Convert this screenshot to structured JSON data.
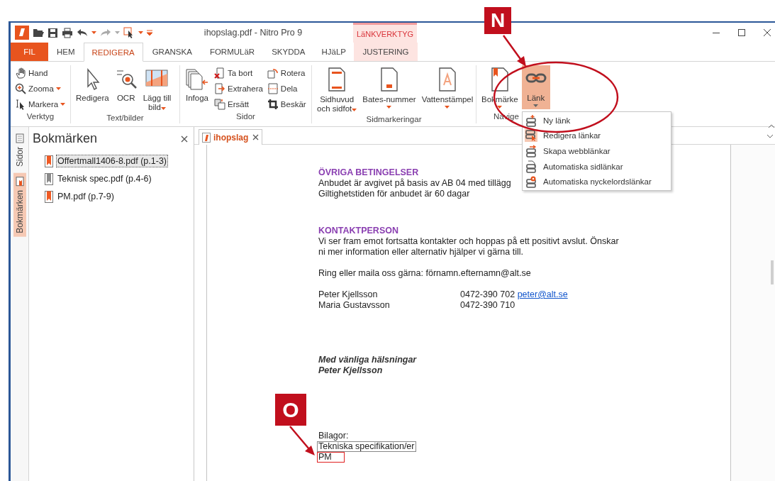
{
  "window": {
    "title": "ihopslag.pdf - Nitro Pro 9",
    "context_group": "LäNKVERKTYG"
  },
  "tabs": [
    {
      "label": "FIL",
      "kind": "file",
      "selected": false
    },
    {
      "label": "HEM",
      "kind": "tab",
      "selected": false
    },
    {
      "label": "REDIGERA",
      "kind": "tab",
      "selected": true
    },
    {
      "label": "GRANSKA",
      "kind": "tab",
      "selected": false
    },
    {
      "label": "FORMULäR",
      "kind": "tab",
      "selected": false
    },
    {
      "label": "SKYDDA",
      "kind": "tab",
      "selected": false
    },
    {
      "label": "HJäLP",
      "kind": "tab",
      "selected": false
    },
    {
      "label": "JUSTERING",
      "kind": "context",
      "selected": false
    }
  ],
  "ribbon": {
    "groups": [
      {
        "label": "Verktyg",
        "items": [
          {
            "label": "Hand",
            "kind": "small",
            "dropdown": false,
            "active": false
          },
          {
            "label": "Zooma",
            "kind": "small",
            "dropdown": true,
            "active": false
          },
          {
            "label": "Markera",
            "kind": "small",
            "dropdown": true,
            "active": false
          }
        ]
      },
      {
        "label": "Text/bilder",
        "items": [
          {
            "label": "Redigera",
            "kind": "large",
            "dropdown": false,
            "active": false
          },
          {
            "label": "OCR",
            "kind": "large",
            "dropdown": false,
            "active": false
          },
          {
            "label": "Lägg till\nbild",
            "kind": "large",
            "dropdown": true,
            "active": false
          }
        ]
      },
      {
        "label": "Sidor",
        "items": [
          {
            "label": "Infoga",
            "kind": "large",
            "dropdown": false,
            "active": false
          },
          {
            "label": "Ta bort",
            "kind": "small",
            "dropdown": false,
            "active": false
          },
          {
            "label": "Extrahera",
            "kind": "small",
            "dropdown": false,
            "active": false
          },
          {
            "label": "Ersätt",
            "kind": "small",
            "dropdown": false,
            "active": false
          },
          {
            "label": "Rotera",
            "kind": "small",
            "dropdown": false,
            "active": false
          },
          {
            "label": "Dela",
            "kind": "small",
            "dropdown": false,
            "active": false
          },
          {
            "label": "Beskär",
            "kind": "small",
            "dropdown": false,
            "active": false
          }
        ]
      },
      {
        "label": "Sidmarkeringar",
        "items": [
          {
            "label": "Sidhuvud\noch sidfot",
            "kind": "large",
            "dropdown": true,
            "active": false
          },
          {
            "label": "Bates-nummer",
            "kind": "large",
            "dropdown": true,
            "active": false
          },
          {
            "label": "Vattenstämpel",
            "kind": "large",
            "dropdown": true,
            "active": false
          }
        ]
      },
      {
        "label": "Navige",
        "items": [
          {
            "label": "Bokmärke",
            "kind": "large",
            "dropdown": true,
            "active": false
          },
          {
            "label": "Länk",
            "kind": "large",
            "dropdown": true,
            "active": true
          }
        ]
      }
    ]
  },
  "side_tabs": [
    {
      "label": "Sidor",
      "selected": false
    },
    {
      "label": "Bokmärken",
      "selected": true
    }
  ],
  "bookmarks": {
    "title": "Bokmärken",
    "items": [
      {
        "label": "Offertmall1406-8.pdf (p.1-3)",
        "selected": true,
        "color": "#f05a24"
      },
      {
        "label": "Teknisk spec.pdf (p.4-6)",
        "selected": false,
        "color": "#8a8a8a"
      },
      {
        "label": "PM.pdf (p.7-9)",
        "selected": false,
        "color": "#f05a24"
      }
    ]
  },
  "document": {
    "tab": {
      "label": "ihopslag",
      "selected": true
    },
    "blocks": [
      {
        "kind": "heading",
        "text": "ÖVRIGA BETINGELSER"
      },
      {
        "kind": "paragraph",
        "lines": [
          "Anbudet är avgivet på basis av AB 04 med tillägg",
          "Giltighetstiden för anbudet är 60 dagar"
        ]
      },
      {
        "kind": "heading",
        "text": "KONTAKTPERSON"
      },
      {
        "kind": "paragraph",
        "lines": [
          "Vi ser fram emot fortsatta kontakter och hoppas på ett positivt avslut. Önskar",
          "ni mer information eller alternativ hjälper vi gärna till."
        ]
      },
      {
        "kind": "paragraph",
        "lines": [
          "Ring eller maila oss gärna: förnamn.efternamn@alt.se"
        ]
      },
      {
        "kind": "contacts",
        "rows": [
          {
            "name": "Peter Kjellsson",
            "phone": "0472-390 702",
            "email": "peter@alt.se"
          },
          {
            "name": "Maria Gustavsson",
            "phone": "0472-390 710"
          }
        ]
      },
      {
        "kind": "closing",
        "lines": [
          "Med vänliga hälsningar",
          "Peter Kjellsson"
        ]
      },
      {
        "kind": "attachments",
        "label": "Bilagor:",
        "links": [
          {
            "text": "Tekniska specifikation/er",
            "selected": false
          },
          {
            "text": "PM",
            "selected": true
          }
        ]
      }
    ]
  },
  "link_menu": {
    "items": [
      {
        "label": "Ny länk",
        "checked": false
      },
      {
        "label": "Redigera länkar",
        "checked": true
      },
      {
        "label": "Skapa webblänkar",
        "checked": false
      },
      {
        "label": "Automatiska sidlänkar",
        "checked": false
      },
      {
        "label": "Automatiska nyckelordslänkar",
        "checked": false
      }
    ]
  },
  "callouts": [
    {
      "label": "N"
    },
    {
      "label": "O"
    }
  ]
}
